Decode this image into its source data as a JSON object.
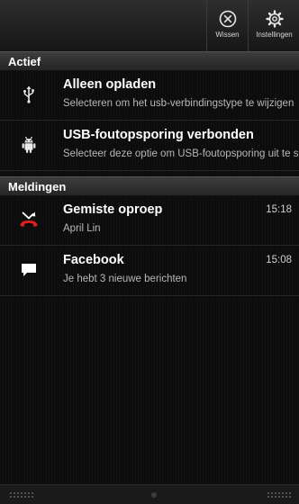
{
  "toolbar": {
    "clear_label": "Wissen",
    "settings_label": "Instellingen"
  },
  "sections": {
    "active": "Actief",
    "notifications": "Meldingen"
  },
  "active_items": [
    {
      "icon": "usb-icon",
      "title": "Alleen opladen",
      "subtitle": "Selecteren om het usb-verbindingstype te wijzigen"
    },
    {
      "icon": "android-debug-icon",
      "title": "USB-foutopsporing verbonden",
      "subtitle": "Selecteer deze optie om USB-foutopsporing uit te schakelen"
    }
  ],
  "notifications": [
    {
      "icon": "missed-call-icon",
      "title": "Gemiste oproep",
      "subtitle": "April Lin",
      "time": "15:18"
    },
    {
      "icon": "message-icon",
      "title": "Facebook",
      "subtitle": "Je hebt 3 nieuwe berichten",
      "time": "15:08"
    }
  ],
  "colors": {
    "background": "#0c0c0c",
    "missed_call": "#e0201c",
    "text_primary": "#ffffff",
    "text_secondary": "#b8b8b8"
  }
}
